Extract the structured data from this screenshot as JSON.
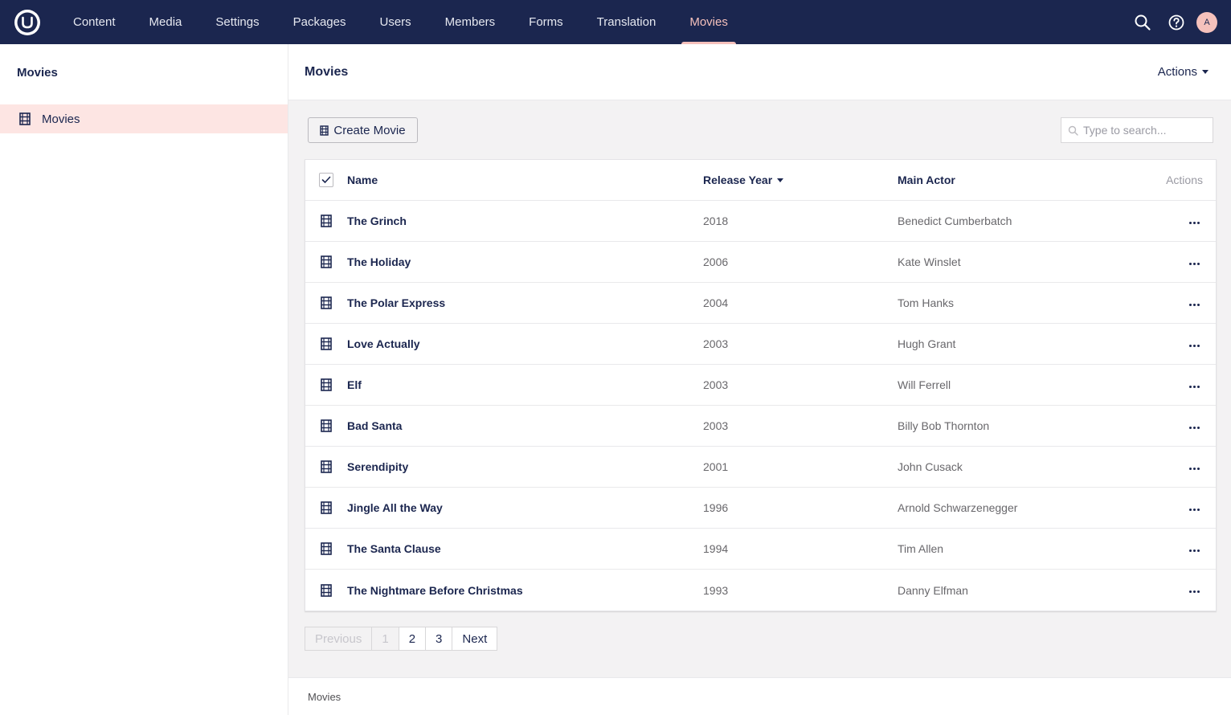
{
  "topbar": {
    "nav": [
      {
        "label": "Content",
        "active": false
      },
      {
        "label": "Media",
        "active": false
      },
      {
        "label": "Settings",
        "active": false
      },
      {
        "label": "Packages",
        "active": false
      },
      {
        "label": "Users",
        "active": false
      },
      {
        "label": "Members",
        "active": false
      },
      {
        "label": "Forms",
        "active": false
      },
      {
        "label": "Translation",
        "active": false
      },
      {
        "label": "Movies",
        "active": true
      }
    ],
    "avatar_initial": "A"
  },
  "sidebar": {
    "title": "Movies",
    "tree": [
      {
        "label": "Movies",
        "icon": "film-icon",
        "selected": true
      }
    ]
  },
  "main": {
    "title": "Movies",
    "actions_label": "Actions",
    "create_button": "Create Movie",
    "search_placeholder": "Type to search...",
    "table": {
      "headers": {
        "name": "Name",
        "year": "Release Year",
        "actor": "Main Actor",
        "actions": "Actions"
      },
      "rows": [
        {
          "name": "The Grinch",
          "year": "2018",
          "actor": "Benedict Cumberbatch"
        },
        {
          "name": "The Holiday",
          "year": "2006",
          "actor": "Kate Winslet"
        },
        {
          "name": "The Polar Express",
          "year": "2004",
          "actor": "Tom Hanks"
        },
        {
          "name": "Love Actually",
          "year": "2003",
          "actor": "Hugh Grant"
        },
        {
          "name": "Elf",
          "year": "2003",
          "actor": "Will Ferrell"
        },
        {
          "name": "Bad Santa",
          "year": "2003",
          "actor": "Billy Bob Thornton"
        },
        {
          "name": "Serendipity",
          "year": "2001",
          "actor": "John Cusack"
        },
        {
          "name": "Jingle All the Way",
          "year": "1996",
          "actor": "Arnold Schwarzenegger"
        },
        {
          "name": "The Santa Clause",
          "year": "1994",
          "actor": "Tim Allen"
        },
        {
          "name": "The Nightmare Before Christmas",
          "year": "1993",
          "actor": "Danny Elfman"
        }
      ]
    },
    "pagination": {
      "previous": "Previous",
      "pages": [
        "1",
        "2",
        "3"
      ],
      "current": "1",
      "next": "Next"
    },
    "footer": "Movies"
  },
  "colors": {
    "topbar": "#1b264f",
    "accent": "#f5c1bc",
    "selected_bg": "#fde5e3"
  }
}
